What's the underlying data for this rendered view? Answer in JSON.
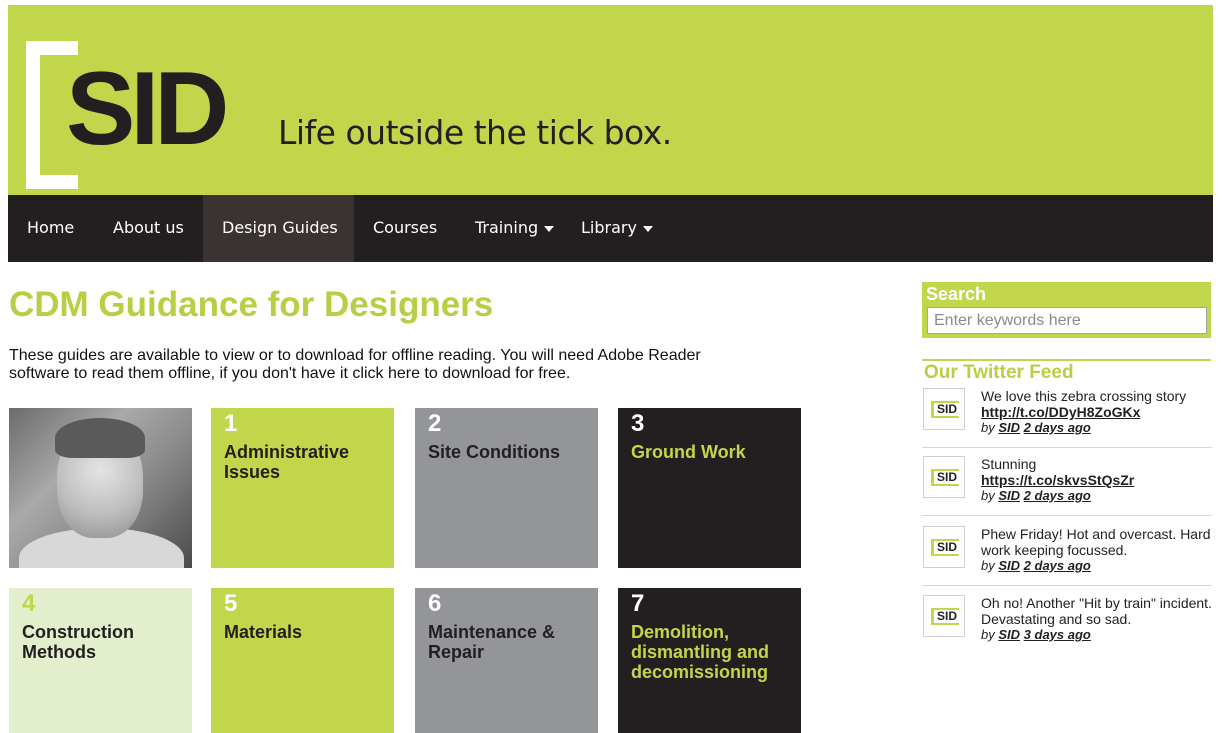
{
  "brand": {
    "logo_text": "SID",
    "tagline": "Life outside the tick box."
  },
  "nav": {
    "items": [
      {
        "label": "Home"
      },
      {
        "label": "About us"
      },
      {
        "label": "Design Guides"
      },
      {
        "label": "Courses"
      },
      {
        "label": "Training"
      },
      {
        "label": "Library"
      }
    ],
    "active": "Design Guides"
  },
  "main": {
    "title": "CDM Guidance for Designers",
    "intro": "These guides are available to view or to download for offline reading. You will need Adobe Reader software to read them offline, if you don't have it click here to download for free.",
    "guides": [
      {
        "num": "1",
        "label": "Administrative Issues"
      },
      {
        "num": "2",
        "label": "Site Conditions"
      },
      {
        "num": "3",
        "label": "Ground Work"
      },
      {
        "num": "4",
        "label": "Construction Methods"
      },
      {
        "num": "5",
        "label": "Materials"
      },
      {
        "num": "6",
        "label": "Maintenance & Repair"
      },
      {
        "num": "7",
        "label": "Demolition, dismantling and decomissioning"
      }
    ]
  },
  "sidebar": {
    "search": {
      "label": "Search",
      "placeholder": "Enter keywords here"
    },
    "twitter": {
      "title": "Our Twitter Feed",
      "avatar_text": "SID",
      "tweets": [
        {
          "text": "We love this zebra crossing story",
          "link": "http://t.co/DDyH8ZoGKx",
          "by": "by",
          "author": "SID",
          "time": "2 days ago"
        },
        {
          "text": "Stunning",
          "link": "https://t.co/skvsStQsZr",
          "by": "by",
          "author": "SID",
          "time": "2 days ago"
        },
        {
          "text": "Phew Friday! Hot and overcast. Hard work keeping focussed.",
          "link": "",
          "by": "by",
          "author": "SID",
          "time": "2 days ago"
        },
        {
          "text": "Oh no! Another \"Hit by train\" incident. Devastating and so sad.",
          "link": "",
          "by": "by",
          "author": "SID",
          "time": "3 days ago"
        }
      ]
    }
  },
  "colors": {
    "brand_green": "#c1d64a",
    "dark": "#231f20",
    "gray": "#939598",
    "light_green": "#e3efcc"
  }
}
